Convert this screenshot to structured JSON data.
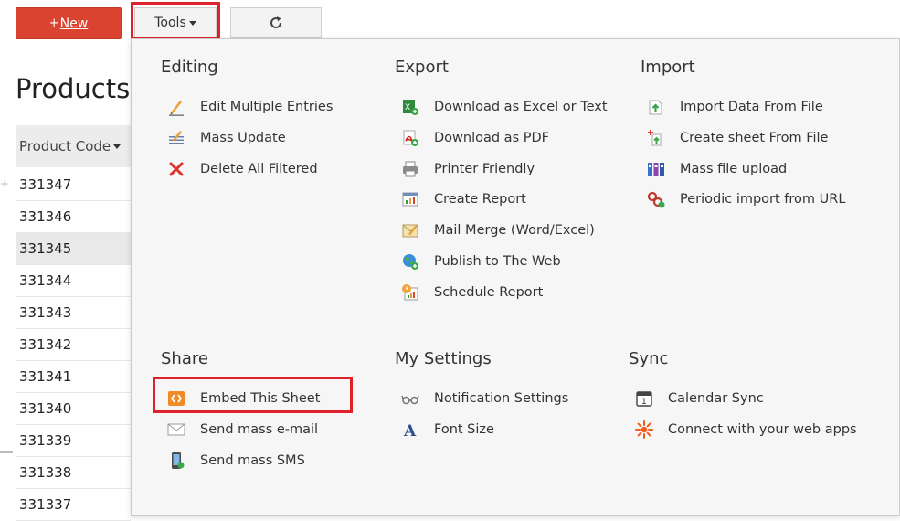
{
  "toolbar": {
    "new_plus": "+",
    "new_label": "New",
    "tools_label": "Tools"
  },
  "page": {
    "title": "Products"
  },
  "table": {
    "column_header": "Product Code",
    "rows": [
      "331347",
      "331346",
      "331345",
      "331344",
      "331343",
      "331342",
      "331341",
      "331340",
      "331339",
      "331338",
      "331337"
    ]
  },
  "menu": {
    "editing": {
      "title": "Editing",
      "items": [
        "Edit Multiple Entries",
        "Mass Update",
        "Delete All Filtered"
      ]
    },
    "export": {
      "title": "Export",
      "items": [
        "Download as Excel or Text",
        "Download as PDF",
        "Printer Friendly",
        "Create Report",
        "Mail Merge (Word/Excel)",
        "Publish to The Web",
        "Schedule Report"
      ]
    },
    "import": {
      "title": "Import",
      "items": [
        "Import Data From File",
        "Create sheet From File",
        "Mass file upload",
        "Periodic import from URL"
      ]
    },
    "share": {
      "title": "Share",
      "items": [
        "Embed This Sheet",
        "Send mass e-mail",
        "Send mass SMS"
      ]
    },
    "my_settings": {
      "title": "My Settings",
      "items": [
        "Notification Settings",
        "Font Size"
      ]
    },
    "sync": {
      "title": "Sync",
      "items": [
        "Calendar Sync",
        "Connect with your web apps"
      ]
    }
  },
  "colors": {
    "new_button": "#d9432f",
    "highlight": "#e0202a",
    "menu_background": "#f6f6f6"
  }
}
